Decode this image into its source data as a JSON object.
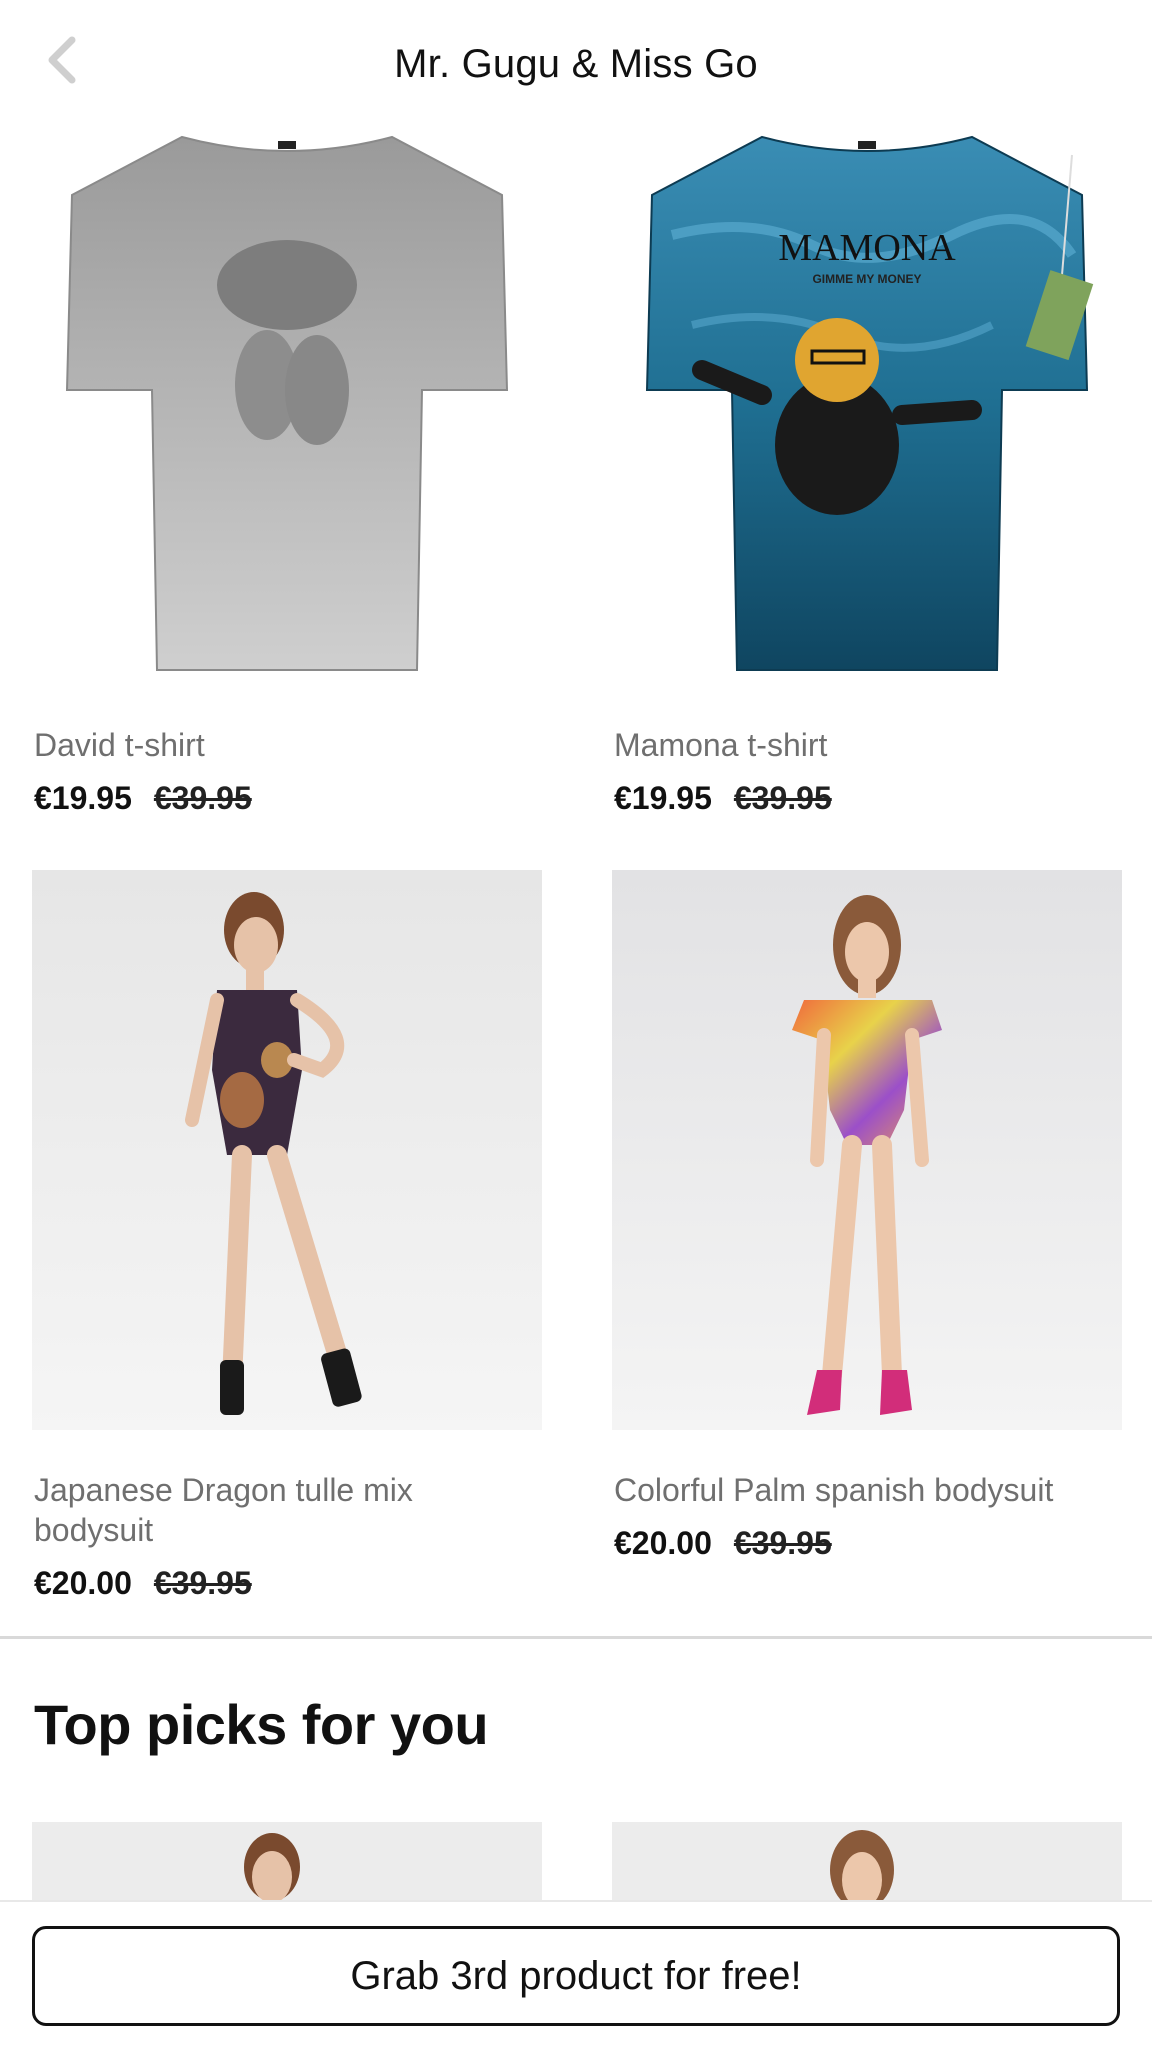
{
  "header": {
    "title": "Mr. Gugu & Miss Go",
    "back_icon": "chevron-left-icon"
  },
  "products": [
    {
      "name": "David t-shirt",
      "price": "€19.95",
      "old_price": "€39.95"
    },
    {
      "name": "Mamona t-shirt",
      "price": "€19.95",
      "old_price": "€39.95",
      "print_text": "MAMONA",
      "print_subtext": "GIMME MY MONEY"
    },
    {
      "name": "Japanese Dragon tulle mix bodysuit",
      "price": "€20.00",
      "old_price": "€39.95"
    },
    {
      "name": "Colorful Palm spanish bodysuit",
      "price": "€20.00",
      "old_price": "€39.95"
    }
  ],
  "section": {
    "title": "Top picks for you"
  },
  "cta": {
    "label": "Grab 3rd product for free!"
  },
  "colors": {
    "accent": "#111111",
    "old_price": "#222222",
    "name_gray": "#6f6f6f"
  }
}
